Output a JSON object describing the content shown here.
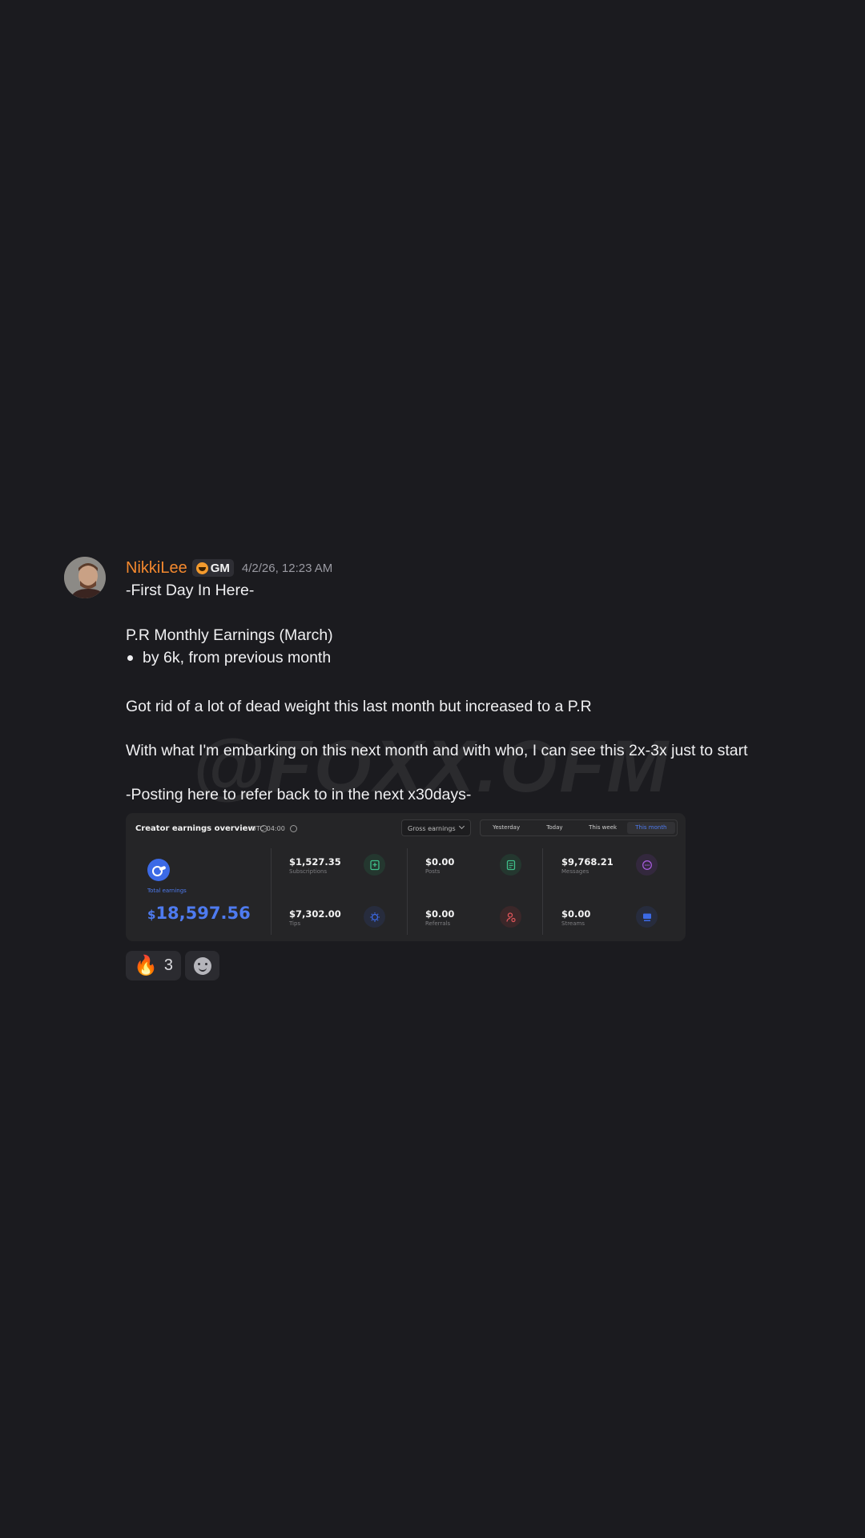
{
  "message": {
    "username": "NikkiLee",
    "role_tag": "GM",
    "timestamp": "4/2/26, 12:23 AM",
    "lines": {
      "l1": "-First Day In Here-",
      "l2": "P.R Monthly Earnings (March)",
      "l3": "by 6k, from previous month",
      "l4": "Got rid of a lot of dead weight this last month but increased to a P.R",
      "l5": "With what I'm embarking on this next month and with who, I can see this 2x-3x just to start",
      "l6": "-Posting here to refer back to in the next x30days-"
    },
    "watermark": "@FOXX.OFM"
  },
  "card": {
    "title": "Creator earnings overview",
    "timezone": "UTC-04:00",
    "select_value": "Gross earnings",
    "tabs": [
      "Yesterday",
      "Today",
      "This week",
      "This month"
    ],
    "active_tab": "This month",
    "total": {
      "label": "Total earnings",
      "currency": "$",
      "value": "18,597.56"
    },
    "stats": {
      "subscriptions": {
        "value": "$1,527.35",
        "label": "Subscriptions",
        "color": "#3fbf8a"
      },
      "posts": {
        "value": "$0.00",
        "label": "Posts",
        "color": "#3fbf8a"
      },
      "messages": {
        "value": "$9,768.21",
        "label": "Messages",
        "color": "#a35ad8"
      },
      "tips": {
        "value": "$7,302.00",
        "label": "Tips",
        "color": "#3c6ae6"
      },
      "referrals": {
        "value": "$0.00",
        "label": "Referrals",
        "color": "#e0555a"
      },
      "streams": {
        "value": "$0.00",
        "label": "Streams",
        "color": "#3c6ae6"
      }
    }
  },
  "reactions": {
    "fire": {
      "emoji": "🔥",
      "count": "3"
    }
  },
  "colors": {
    "background": "#1b1b1f",
    "username": "#f3882e",
    "accent": "#4e7bf0"
  }
}
